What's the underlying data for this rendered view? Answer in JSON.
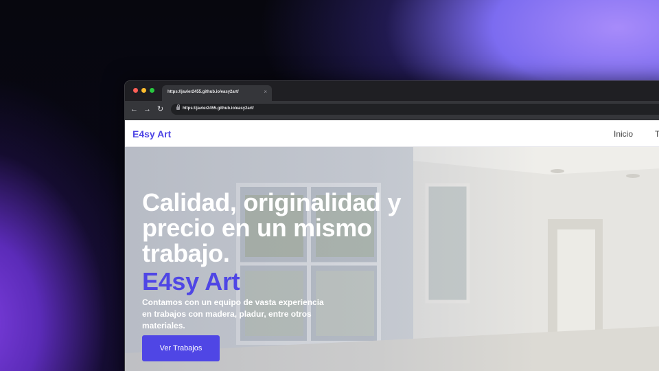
{
  "browser": {
    "tab_title": "https://javier2455.github.io/easy2art/",
    "tab_close": "×",
    "url": "https://javier2455.github.io/easy2art/",
    "back": "←",
    "forward": "→",
    "reload": "↻"
  },
  "site": {
    "brand": "E4sy Art",
    "nav": [
      "Inicio",
      "T"
    ]
  },
  "hero": {
    "title": "Calidad, originalidad y precio en un mismo trabajo.",
    "brand": "E4sy Art",
    "description": "Contamos con un equipo de vasta experiencia en trabajos con madera, pladur, entre otros materiales.",
    "cta": "Ver Trabajos"
  },
  "colors": {
    "accent": "#4f46e5",
    "backdrop_glow": "#a78bfa"
  }
}
